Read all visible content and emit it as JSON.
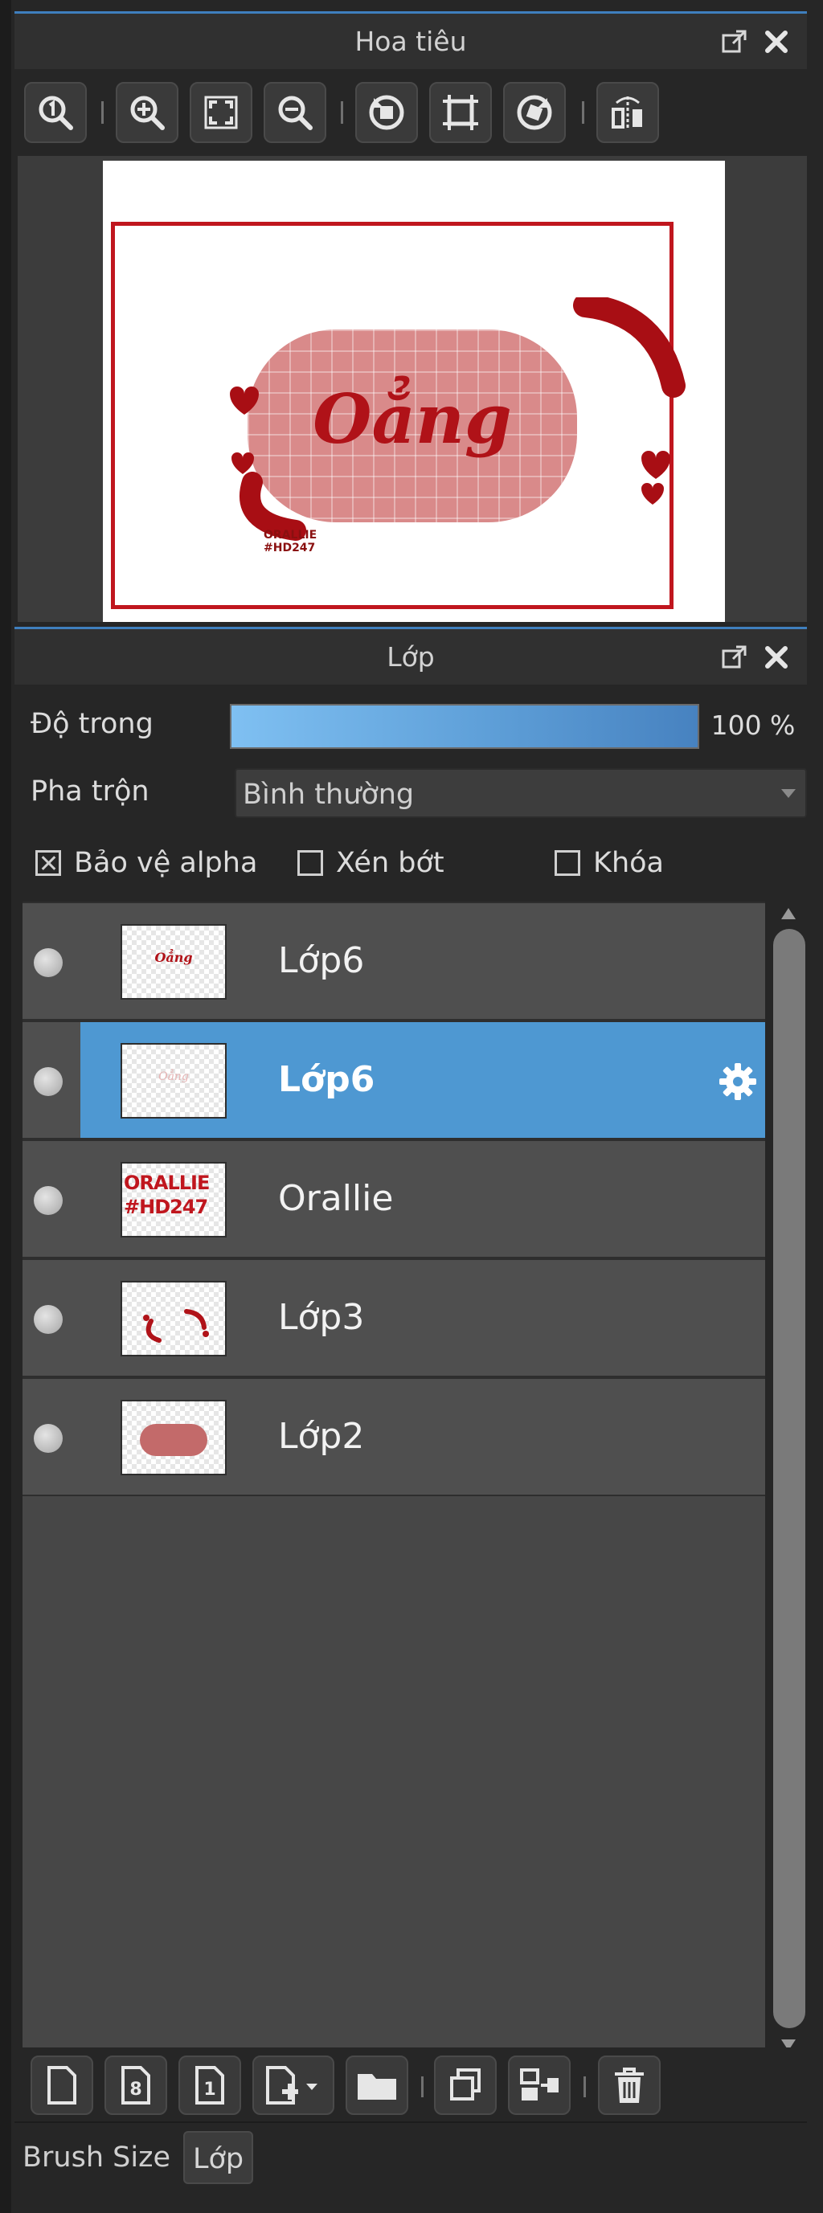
{
  "navigator_panel": {
    "title": "Hoa tiêu",
    "toolbar": [
      "zoom-actual-icon",
      "zoom-in-icon",
      "fit-screen-icon",
      "zoom-out-icon",
      "rotate-left-icon",
      "crop-frame-icon",
      "rotate-right-icon",
      "flip-horizontal-icon"
    ],
    "canvas_preview": {
      "word": "Oẳng",
      "watermark": [
        "ORALLIE",
        "#HD247"
      ]
    }
  },
  "layer_panel": {
    "title": "Lớp",
    "opacity": {
      "label": "Độ trong",
      "value_text": "100 %",
      "value": 1.0
    },
    "blend": {
      "label": "Pha trộn",
      "value": "Bình thường"
    },
    "checkboxes": {
      "protect_alpha": {
        "label": "Bảo vệ alpha",
        "checked": true
      },
      "clipping": {
        "label": "Xén bớt",
        "checked": false
      },
      "lock": {
        "label": "Khóa",
        "checked": false
      }
    },
    "layers": [
      {
        "name": "Lớp6",
        "thumb_text": "Oẳng",
        "selected": false
      },
      {
        "name": "Lớp6",
        "thumb_text": "Oẳng",
        "selected": true
      },
      {
        "name": "Orallie",
        "thumb_text": [
          "ORALLIE",
          "#HD247"
        ],
        "selected": false
      },
      {
        "name": "Lớp3",
        "selected": false
      },
      {
        "name": "Lớp2",
        "selected": false
      }
    ],
    "toolbar_glyphs": {
      "new_8bit": "8",
      "new_1bit": "1"
    }
  },
  "tabs": [
    {
      "label": "Brush Size",
      "active": false
    },
    {
      "label": "Lớp",
      "active": true
    }
  ],
  "colors": {
    "accent_blue": "#4e98d2",
    "panel_bg": "#262626",
    "layer_row_bg": "#4f4f4f",
    "artwork_red": "#b01218"
  }
}
